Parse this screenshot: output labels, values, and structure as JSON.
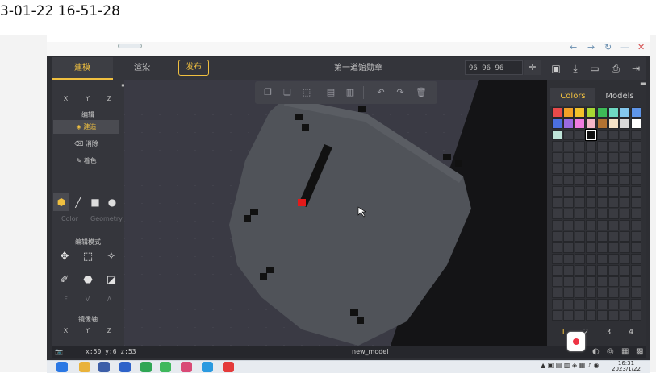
{
  "screen": {
    "timestamp_text": "3-01-22 16-51-28"
  },
  "browser": {
    "window_controls": [
      "←",
      "→",
      "↻",
      "—",
      "✕"
    ]
  },
  "app": {
    "menu": {
      "tabs": [
        "建模",
        "渲染"
      ],
      "active_tab": 0,
      "publish_label": "发布",
      "title": "第一道馆勋章",
      "dims_value": "96 96 96"
    },
    "toolbar_right_icons": [
      "save-icon",
      "download-icon",
      "folder-icon",
      "print-icon",
      "exit-icon"
    ],
    "left_panel": {
      "xyz_labels": [
        "X",
        "Y",
        "Z"
      ],
      "edit_header": "编辑",
      "modes": [
        "建造",
        "消除",
        "着色"
      ],
      "active_mode": 0,
      "shape_tabs": [
        "Color",
        "Geometry"
      ],
      "edit_mode_header": "编辑模式",
      "fva_labels": [
        "F",
        "V",
        "A"
      ],
      "mirror_header": "镜像轴",
      "rotate_header": "旋转轴"
    },
    "float_toolbar_icons": [
      "copy-icon",
      "paste-icon",
      "select-icon",
      "layer-icon",
      "layer2-icon",
      "undo-icon",
      "redo-icon",
      "delete-icon"
    ],
    "right_panel": {
      "tabs": [
        "Colors",
        "Models"
      ],
      "active_tab": 0,
      "palette": [
        "#e84a4a",
        "#f2a127",
        "#f3c22b",
        "#a8d833",
        "#3dbb57",
        "#6fd9c3",
        "#84c8ef",
        "#5e95e8",
        "#4b6fe0",
        "#9b6ae0",
        "#f07ce0",
        "#f5b6c8",
        "#b37332",
        "#f5e3c8",
        "#d9d9d9",
        "#ffffff",
        "#bfe3d8",
        "",
        "",
        "#111111",
        "",
        "",
        "",
        ""
      ],
      "selected_index": 19,
      "pages": [
        "1",
        "2",
        "3",
        "4"
      ],
      "active_page": 0
    },
    "status": {
      "coords": "x:50 y:6 z:53",
      "model_name": "new_model"
    }
  },
  "taskbar": {
    "clock_time": "16:31",
    "clock_date": "2023/1/22"
  }
}
